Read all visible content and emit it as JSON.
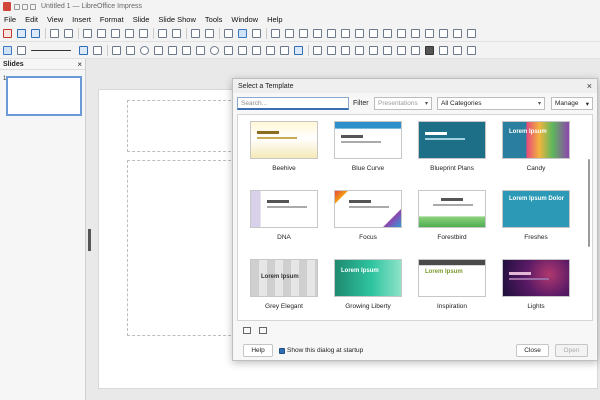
{
  "window": {
    "title": "Untitled 1 — LibreOffice Impress"
  },
  "menubar": {
    "items": [
      "File",
      "Edit",
      "View",
      "Insert",
      "Format",
      "Slide",
      "Slide Show",
      "Tools",
      "Window",
      "Help"
    ]
  },
  "slides_panel": {
    "title": "Slides",
    "close": "×",
    "slide_number": "1"
  },
  "dialog": {
    "title": "Select a Template",
    "close": "×",
    "search_placeholder": "Search...",
    "filter_label": "Filter",
    "filter_app": "Presentations",
    "filter_category": "All Categories",
    "manage_label": "Manage",
    "templates": [
      {
        "name": "Beehive"
      },
      {
        "name": "Blue Curve"
      },
      {
        "name": "Blueprint Plans"
      },
      {
        "name": "Candy"
      },
      {
        "name": "DNA"
      },
      {
        "name": "Focus"
      },
      {
        "name": "Forestbird"
      },
      {
        "name": "Freshes"
      },
      {
        "name": "Grey Elegant"
      },
      {
        "name": "Growing Liberty"
      },
      {
        "name": "Inspiration"
      },
      {
        "name": "Lights"
      }
    ],
    "thumb_text": {
      "candy": "Lorem Ipsum",
      "freshes": "Lorem Ipsum Dolor",
      "grey": "Lorem Ipsum",
      "growing": "Lorem Ipsum",
      "inspiration": "Lorem Ipsum"
    },
    "help_label": "Help",
    "startup_label": "Show this dialog at startup",
    "close_label": "Close",
    "open_label": "Open"
  },
  "colors": {
    "accent": "#2f6db5",
    "window_bg": "#f3f3f3"
  }
}
